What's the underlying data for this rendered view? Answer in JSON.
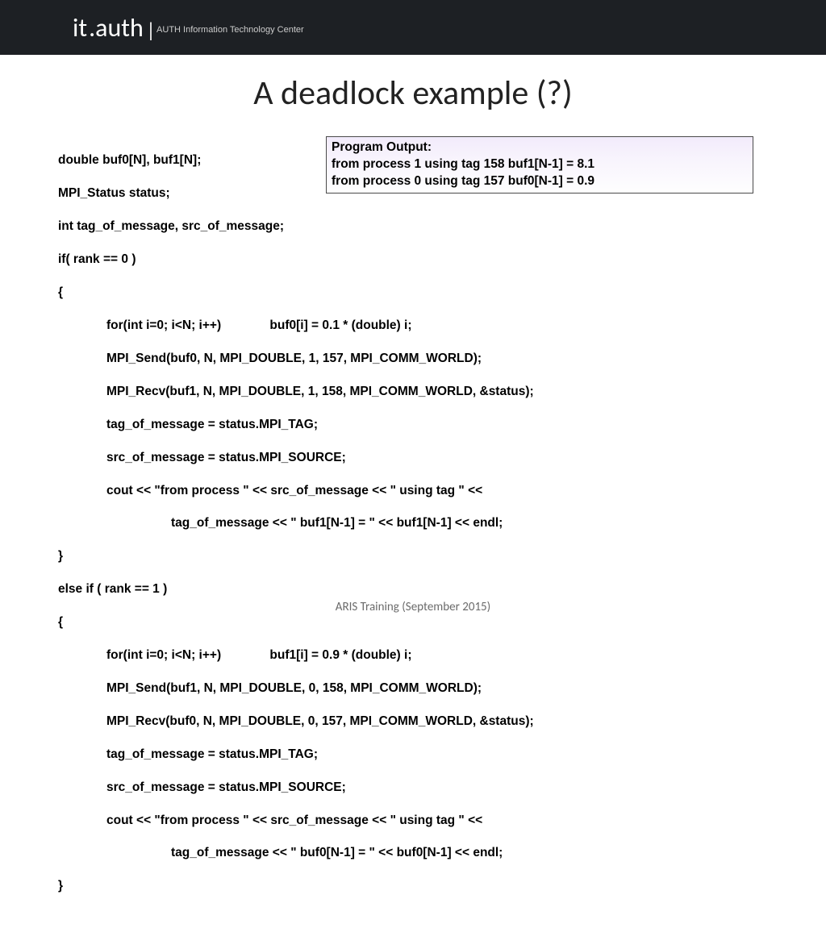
{
  "header": {
    "logo_it": "it",
    "logo_dot_auth": ".auth",
    "logo_bar": "|",
    "logo_sub": "AUTH Information Technology Center"
  },
  "title": "A deadlock example (?)",
  "output": {
    "line1": "Program Output:",
    "line2": "from process 1 using tag 158 buf1[N-1] = 8.1",
    "line3": "from process 0 using tag 157 buf0[N-1] = 0.9"
  },
  "code": {
    "l01": "double buf0[N], buf1[N];",
    "l02": "MPI_Status status;",
    "l03": "int tag_of_message, src_of_message;",
    "l04": "if( rank == 0 )",
    "l05": "{",
    "l06": "for(int i=0; i<N; i++)              buf0[i] = 0.1 * (double) i;",
    "l07": "MPI_Send(buf0, N, MPI_DOUBLE, 1, 157, MPI_COMM_WORLD);",
    "l08": "MPI_Recv(buf1, N, MPI_DOUBLE, 1, 158, MPI_COMM_WORLD, &status);",
    "l09": "tag_of_message = status.MPI_TAG;",
    "l10": "src_of_message = status.MPI_SOURCE;",
    "l11": "cout << \"from process \" << src_of_message << \" using tag \" <<",
    "l12": "tag_of_message << \" buf1[N-1] = \" << buf1[N-1] << endl;",
    "l13": "}",
    "l14": "else if ( rank == 1 )",
    "l15": "{",
    "l16": "for(int i=0; i<N; i++)              buf1[i] = 0.9 * (double) i;",
    "l17": "MPI_Send(buf1, N, MPI_DOUBLE, 0, 158, MPI_COMM_WORLD);",
    "l18": "MPI_Recv(buf0, N, MPI_DOUBLE, 0, 157, MPI_COMM_WORLD, &status);",
    "l19": "tag_of_message = status.MPI_TAG;",
    "l20": "src_of_message = status.MPI_SOURCE;",
    "l21": "cout << \"from process \" << src_of_message << \" using tag \" <<",
    "l22": "tag_of_message << \" buf0[N-1] = \" << buf0[N-1] << endl;",
    "l23": "}"
  },
  "footer": "ARIS Training (September 2015)"
}
